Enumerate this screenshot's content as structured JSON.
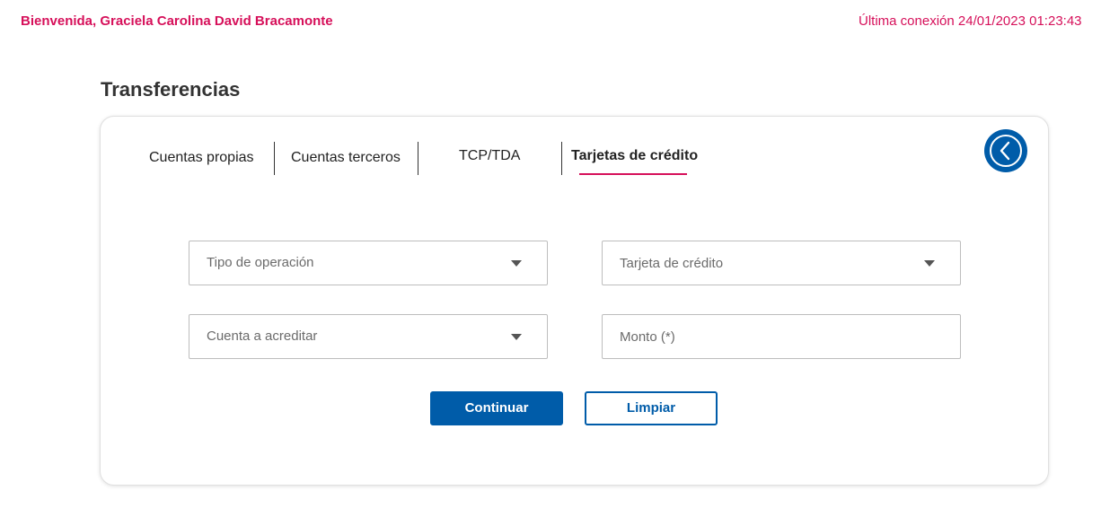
{
  "header": {
    "welcome": "Bienvenida, Graciela Carolina David Bracamonte",
    "last_connection": "Última conexión 24/01/2023 01:23:43"
  },
  "page": {
    "title": "Transferencias"
  },
  "tabs": [
    {
      "label": "Cuentas propias",
      "active": false
    },
    {
      "label": "Cuentas terceros",
      "active": false
    },
    {
      "label": "TCP/TDA",
      "active": false
    },
    {
      "label": "Tarjetas de crédito",
      "active": true
    }
  ],
  "back_button": {
    "icon": "chevron-left-icon"
  },
  "form": {
    "tipo_operacion": {
      "placeholder": "Tipo de operación"
    },
    "tarjeta_credito": {
      "placeholder": "Tarjeta de crédito"
    },
    "cuenta_acreditar": {
      "placeholder": "Cuenta a acreditar"
    },
    "monto": {
      "placeholder": "Monto (*)",
      "value": ""
    }
  },
  "actions": {
    "continue": "Continuar",
    "clear": "Limpiar"
  },
  "colors": {
    "accent": "#d6105a",
    "primary": "#005ca9",
    "text": "#333333"
  }
}
